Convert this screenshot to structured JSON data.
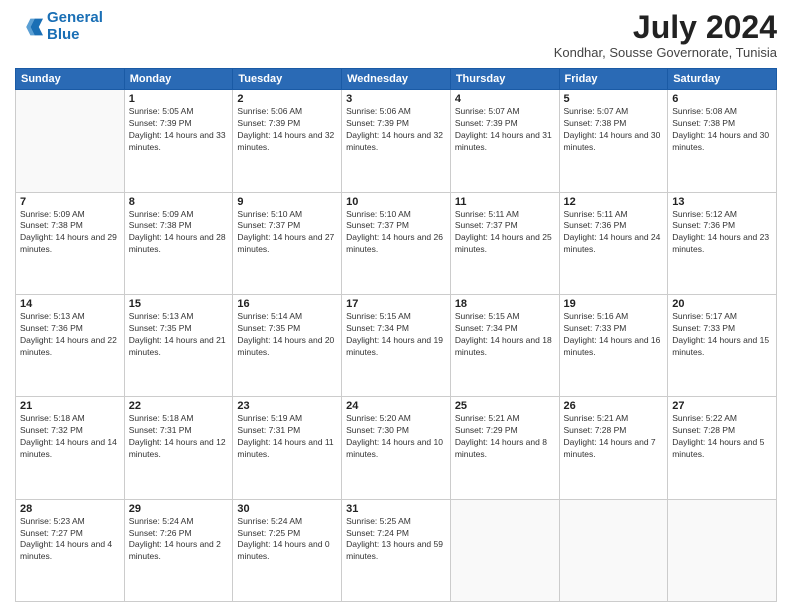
{
  "header": {
    "logo_line1": "General",
    "logo_line2": "Blue",
    "month_year": "July 2024",
    "location": "Kondhar, Sousse Governorate, Tunisia"
  },
  "weekdays": [
    "Sunday",
    "Monday",
    "Tuesday",
    "Wednesday",
    "Thursday",
    "Friday",
    "Saturday"
  ],
  "weeks": [
    [
      {
        "day": "",
        "sunrise": "",
        "sunset": "",
        "daylight": ""
      },
      {
        "day": "1",
        "sunrise": "5:05 AM",
        "sunset": "7:39 PM",
        "daylight": "14 hours and 33 minutes."
      },
      {
        "day": "2",
        "sunrise": "5:06 AM",
        "sunset": "7:39 PM",
        "daylight": "14 hours and 32 minutes."
      },
      {
        "day": "3",
        "sunrise": "5:06 AM",
        "sunset": "7:39 PM",
        "daylight": "14 hours and 32 minutes."
      },
      {
        "day": "4",
        "sunrise": "5:07 AM",
        "sunset": "7:39 PM",
        "daylight": "14 hours and 31 minutes."
      },
      {
        "day": "5",
        "sunrise": "5:07 AM",
        "sunset": "7:38 PM",
        "daylight": "14 hours and 30 minutes."
      },
      {
        "day": "6",
        "sunrise": "5:08 AM",
        "sunset": "7:38 PM",
        "daylight": "14 hours and 30 minutes."
      }
    ],
    [
      {
        "day": "7",
        "sunrise": "5:09 AM",
        "sunset": "7:38 PM",
        "daylight": "14 hours and 29 minutes."
      },
      {
        "day": "8",
        "sunrise": "5:09 AM",
        "sunset": "7:38 PM",
        "daylight": "14 hours and 28 minutes."
      },
      {
        "day": "9",
        "sunrise": "5:10 AM",
        "sunset": "7:37 PM",
        "daylight": "14 hours and 27 minutes."
      },
      {
        "day": "10",
        "sunrise": "5:10 AM",
        "sunset": "7:37 PM",
        "daylight": "14 hours and 26 minutes."
      },
      {
        "day": "11",
        "sunrise": "5:11 AM",
        "sunset": "7:37 PM",
        "daylight": "14 hours and 25 minutes."
      },
      {
        "day": "12",
        "sunrise": "5:11 AM",
        "sunset": "7:36 PM",
        "daylight": "14 hours and 24 minutes."
      },
      {
        "day": "13",
        "sunrise": "5:12 AM",
        "sunset": "7:36 PM",
        "daylight": "14 hours and 23 minutes."
      }
    ],
    [
      {
        "day": "14",
        "sunrise": "5:13 AM",
        "sunset": "7:36 PM",
        "daylight": "14 hours and 22 minutes."
      },
      {
        "day": "15",
        "sunrise": "5:13 AM",
        "sunset": "7:35 PM",
        "daylight": "14 hours and 21 minutes."
      },
      {
        "day": "16",
        "sunrise": "5:14 AM",
        "sunset": "7:35 PM",
        "daylight": "14 hours and 20 minutes."
      },
      {
        "day": "17",
        "sunrise": "5:15 AM",
        "sunset": "7:34 PM",
        "daylight": "14 hours and 19 minutes."
      },
      {
        "day": "18",
        "sunrise": "5:15 AM",
        "sunset": "7:34 PM",
        "daylight": "14 hours and 18 minutes."
      },
      {
        "day": "19",
        "sunrise": "5:16 AM",
        "sunset": "7:33 PM",
        "daylight": "14 hours and 16 minutes."
      },
      {
        "day": "20",
        "sunrise": "5:17 AM",
        "sunset": "7:33 PM",
        "daylight": "14 hours and 15 minutes."
      }
    ],
    [
      {
        "day": "21",
        "sunrise": "5:18 AM",
        "sunset": "7:32 PM",
        "daylight": "14 hours and 14 minutes."
      },
      {
        "day": "22",
        "sunrise": "5:18 AM",
        "sunset": "7:31 PM",
        "daylight": "14 hours and 12 minutes."
      },
      {
        "day": "23",
        "sunrise": "5:19 AM",
        "sunset": "7:31 PM",
        "daylight": "14 hours and 11 minutes."
      },
      {
        "day": "24",
        "sunrise": "5:20 AM",
        "sunset": "7:30 PM",
        "daylight": "14 hours and 10 minutes."
      },
      {
        "day": "25",
        "sunrise": "5:21 AM",
        "sunset": "7:29 PM",
        "daylight": "14 hours and 8 minutes."
      },
      {
        "day": "26",
        "sunrise": "5:21 AM",
        "sunset": "7:28 PM",
        "daylight": "14 hours and 7 minutes."
      },
      {
        "day": "27",
        "sunrise": "5:22 AM",
        "sunset": "7:28 PM",
        "daylight": "14 hours and 5 minutes."
      }
    ],
    [
      {
        "day": "28",
        "sunrise": "5:23 AM",
        "sunset": "7:27 PM",
        "daylight": "14 hours and 4 minutes."
      },
      {
        "day": "29",
        "sunrise": "5:24 AM",
        "sunset": "7:26 PM",
        "daylight": "14 hours and 2 minutes."
      },
      {
        "day": "30",
        "sunrise": "5:24 AM",
        "sunset": "7:25 PM",
        "daylight": "14 hours and 0 minutes."
      },
      {
        "day": "31",
        "sunrise": "5:25 AM",
        "sunset": "7:24 PM",
        "daylight": "13 hours and 59 minutes."
      },
      {
        "day": "",
        "sunrise": "",
        "sunset": "",
        "daylight": ""
      },
      {
        "day": "",
        "sunrise": "",
        "sunset": "",
        "daylight": ""
      },
      {
        "day": "",
        "sunrise": "",
        "sunset": "",
        "daylight": ""
      }
    ]
  ],
  "labels": {
    "sunrise_prefix": "Sunrise: ",
    "sunset_prefix": "Sunset: ",
    "daylight_prefix": "Daylight: "
  }
}
